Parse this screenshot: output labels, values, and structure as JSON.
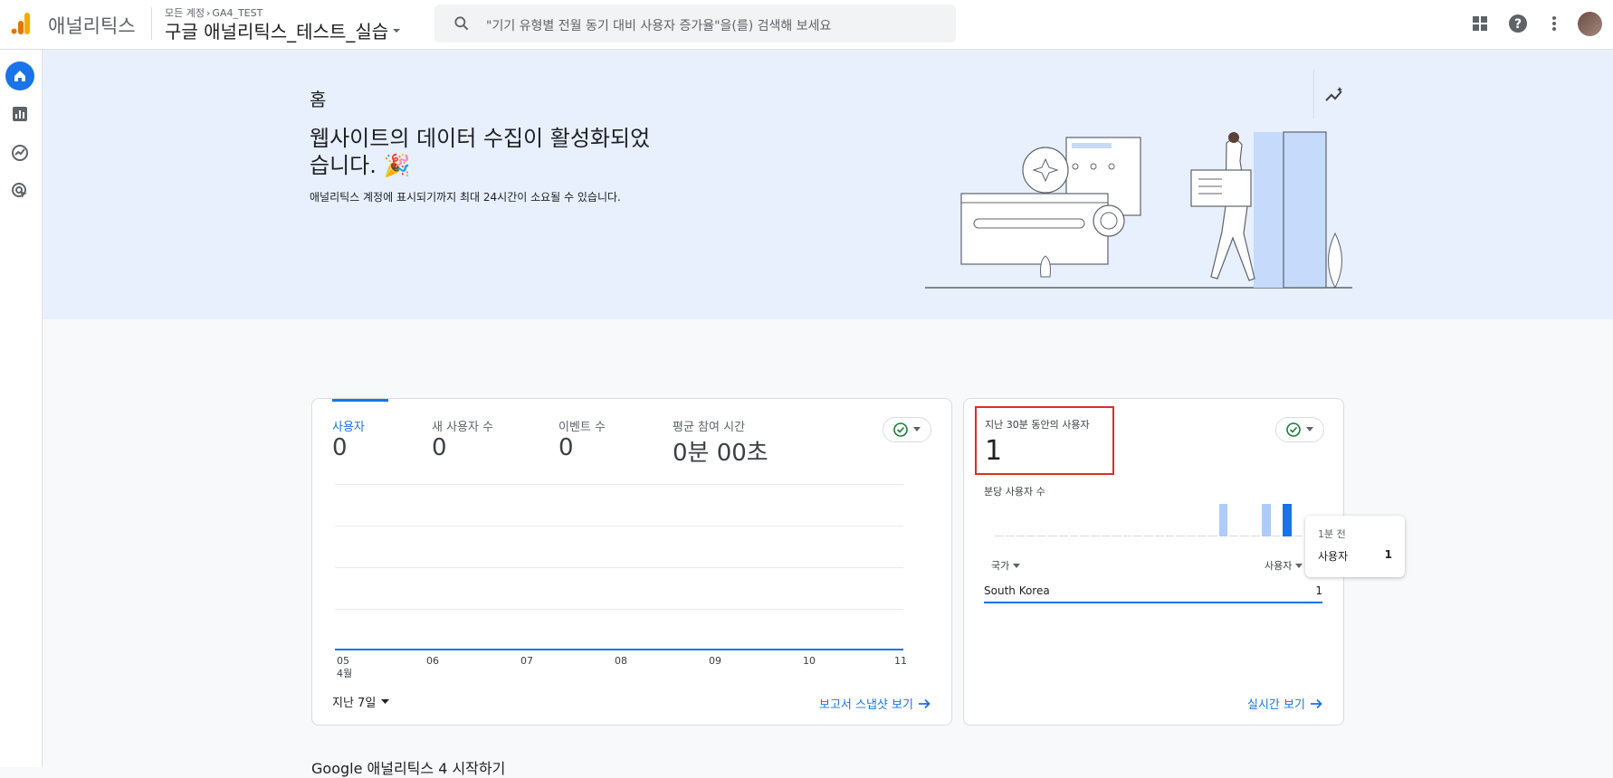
{
  "header": {
    "app_name": "애널리틱스",
    "breadcrumb_account": "모든 계정",
    "breadcrumb_separator": "›",
    "breadcrumb_item": "GA4_TEST",
    "property_name": "구글 애널리틱스_테스트_실습",
    "search_placeholder": "\"기기 유형별 전월 동기 대비 사용자 증가율\"을(를) 검색해 보세요"
  },
  "banner": {
    "title": "홈",
    "headline": "웹사이트의 데이터 수집이 활성화되었습니다. 🎉",
    "subtext": "애널리틱스 계정에 표시되기까지 최대 24시간이 소요될 수 있습니다."
  },
  "overview_card": {
    "metrics": [
      {
        "label": "사용자",
        "value": "0"
      },
      {
        "label": "새 사용자 수",
        "value": "0"
      },
      {
        "label": "이벤트 수",
        "value": "0"
      },
      {
        "label": "평균 참여 시간",
        "value": "0분 00초"
      }
    ],
    "chart_data": {
      "type": "line",
      "x": [
        "05",
        "06",
        "07",
        "08",
        "09",
        "10",
        "11"
      ],
      "x_sublabel": "4월",
      "series": [
        {
          "values": [
            0,
            0,
            0,
            0,
            0,
            0,
            0
          ]
        }
      ],
      "grid": true
    },
    "date_range": "지난 7일",
    "snapshot_link": "보고서 스냅샷 보기"
  },
  "realtime_card": {
    "title": "지난 30분 동안의 사용자",
    "value": "1",
    "per_minute_label": "분당 사용자 수",
    "chart_data": {
      "type": "bar",
      "values": [
        0,
        0,
        0,
        0,
        0,
        0,
        0,
        0,
        0,
        0,
        0,
        0,
        0,
        0,
        0,
        0,
        0,
        0,
        0,
        0,
        0,
        1,
        0,
        0,
        0,
        1,
        0,
        1,
        0
      ],
      "highlight_index": 27,
      "colors": {
        "bar": "#aecbfa",
        "highlight": "#1a73e8"
      }
    },
    "dimension_label": "국가",
    "metric_label": "사용자",
    "rows": [
      {
        "country": "South Korea",
        "users": "1"
      }
    ],
    "realtime_link": "실시간 보기"
  },
  "tooltip": {
    "time": "1분 전",
    "label": "사용자",
    "value": "1"
  },
  "bottom_text": "Google 애널리틱스 4 시작하기",
  "colors": {
    "accent": "#1a73e8",
    "banner": "#e8f0fe",
    "highlight_border": "#d93025",
    "check": "#188038"
  }
}
